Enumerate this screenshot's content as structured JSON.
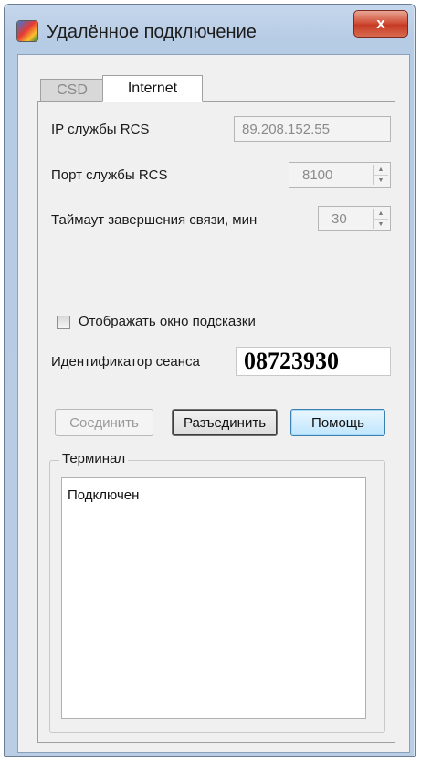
{
  "window": {
    "title": "Удалённое подключение",
    "close_label": "x"
  },
  "tabs": [
    {
      "label": "CSD",
      "active": false
    },
    {
      "label": "Internet",
      "active": true
    }
  ],
  "form": {
    "ip_label": "IP службы RCS",
    "ip_value": "89.208.152.55",
    "port_label": "Порт службы  RCS",
    "port_value": "8100",
    "timeout_label": "Таймаут завершения связи, мин",
    "timeout_value": "30",
    "show_hint_label": "Отображать окно подсказки",
    "show_hint_checked": false,
    "session_label": "Идентификатор сеанса",
    "session_value": "08723930"
  },
  "buttons": {
    "connect": "Соединить",
    "disconnect": "Разъединить",
    "help": "Помощь"
  },
  "terminal": {
    "title": "Терминал",
    "text": "Подключен"
  },
  "colors": {
    "frame": "#b9cde5",
    "close_button": "#c63b24",
    "help_button": "#bee6fd"
  }
}
